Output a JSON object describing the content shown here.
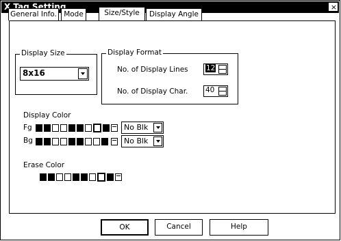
{
  "window": {
    "title": "X Tag Setting",
    "close_symbol": "×"
  },
  "tabs": [
    {
      "label": "General Info.",
      "active": false
    },
    {
      "label": "Mode",
      "active": false
    },
    {
      "label": "Size/Style",
      "active": true
    },
    {
      "label": "Display Angle",
      "active": false
    }
  ],
  "display_size": {
    "legend": "Display Size",
    "value": "8x16"
  },
  "display_format": {
    "legend": "Display Format",
    "lines_label": "No. of Display Lines",
    "lines_value": "12",
    "chars_label": "No. of Display Char.",
    "chars_value": "40"
  },
  "display_color": {
    "label": "Display Color",
    "fg_label": "Fg",
    "bg_label": "Bg",
    "fg_select": "No Blk",
    "bg_select": "No Blk"
  },
  "erase_color": {
    "label": "Erase Color"
  },
  "buttons": {
    "ok": "OK",
    "cancel": "Cancel",
    "help": "Help"
  }
}
